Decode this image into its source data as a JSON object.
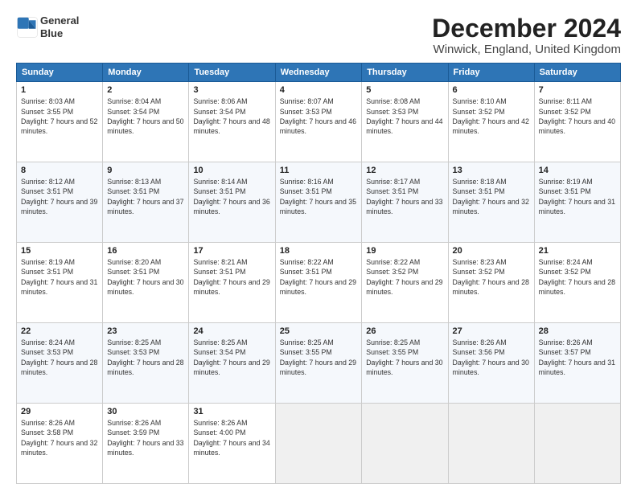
{
  "logo": {
    "line1": "General",
    "line2": "Blue"
  },
  "title": "December 2024",
  "subtitle": "Winwick, England, United Kingdom",
  "days_of_week": [
    "Sunday",
    "Monday",
    "Tuesday",
    "Wednesday",
    "Thursday",
    "Friday",
    "Saturday"
  ],
  "weeks": [
    [
      {
        "day": "1",
        "sunrise": "8:03 AM",
        "sunset": "3:55 PM",
        "daylight": "7 hours and 52 minutes."
      },
      {
        "day": "2",
        "sunrise": "8:04 AM",
        "sunset": "3:54 PM",
        "daylight": "7 hours and 50 minutes."
      },
      {
        "day": "3",
        "sunrise": "8:06 AM",
        "sunset": "3:54 PM",
        "daylight": "7 hours and 48 minutes."
      },
      {
        "day": "4",
        "sunrise": "8:07 AM",
        "sunset": "3:53 PM",
        "daylight": "7 hours and 46 minutes."
      },
      {
        "day": "5",
        "sunrise": "8:08 AM",
        "sunset": "3:53 PM",
        "daylight": "7 hours and 44 minutes."
      },
      {
        "day": "6",
        "sunrise": "8:10 AM",
        "sunset": "3:52 PM",
        "daylight": "7 hours and 42 minutes."
      },
      {
        "day": "7",
        "sunrise": "8:11 AM",
        "sunset": "3:52 PM",
        "daylight": "7 hours and 40 minutes."
      }
    ],
    [
      {
        "day": "8",
        "sunrise": "8:12 AM",
        "sunset": "3:51 PM",
        "daylight": "7 hours and 39 minutes."
      },
      {
        "day": "9",
        "sunrise": "8:13 AM",
        "sunset": "3:51 PM",
        "daylight": "7 hours and 37 minutes."
      },
      {
        "day": "10",
        "sunrise": "8:14 AM",
        "sunset": "3:51 PM",
        "daylight": "7 hours and 36 minutes."
      },
      {
        "day": "11",
        "sunrise": "8:16 AM",
        "sunset": "3:51 PM",
        "daylight": "7 hours and 35 minutes."
      },
      {
        "day": "12",
        "sunrise": "8:17 AM",
        "sunset": "3:51 PM",
        "daylight": "7 hours and 33 minutes."
      },
      {
        "day": "13",
        "sunrise": "8:18 AM",
        "sunset": "3:51 PM",
        "daylight": "7 hours and 32 minutes."
      },
      {
        "day": "14",
        "sunrise": "8:19 AM",
        "sunset": "3:51 PM",
        "daylight": "7 hours and 31 minutes."
      }
    ],
    [
      {
        "day": "15",
        "sunrise": "8:19 AM",
        "sunset": "3:51 PM",
        "daylight": "7 hours and 31 minutes."
      },
      {
        "day": "16",
        "sunrise": "8:20 AM",
        "sunset": "3:51 PM",
        "daylight": "7 hours and 30 minutes."
      },
      {
        "day": "17",
        "sunrise": "8:21 AM",
        "sunset": "3:51 PM",
        "daylight": "7 hours and 29 minutes."
      },
      {
        "day": "18",
        "sunrise": "8:22 AM",
        "sunset": "3:51 PM",
        "daylight": "7 hours and 29 minutes."
      },
      {
        "day": "19",
        "sunrise": "8:22 AM",
        "sunset": "3:52 PM",
        "daylight": "7 hours and 29 minutes."
      },
      {
        "day": "20",
        "sunrise": "8:23 AM",
        "sunset": "3:52 PM",
        "daylight": "7 hours and 28 minutes."
      },
      {
        "day": "21",
        "sunrise": "8:24 AM",
        "sunset": "3:52 PM",
        "daylight": "7 hours and 28 minutes."
      }
    ],
    [
      {
        "day": "22",
        "sunrise": "8:24 AM",
        "sunset": "3:53 PM",
        "daylight": "7 hours and 28 minutes."
      },
      {
        "day": "23",
        "sunrise": "8:25 AM",
        "sunset": "3:53 PM",
        "daylight": "7 hours and 28 minutes."
      },
      {
        "day": "24",
        "sunrise": "8:25 AM",
        "sunset": "3:54 PM",
        "daylight": "7 hours and 29 minutes."
      },
      {
        "day": "25",
        "sunrise": "8:25 AM",
        "sunset": "3:55 PM",
        "daylight": "7 hours and 29 minutes."
      },
      {
        "day": "26",
        "sunrise": "8:25 AM",
        "sunset": "3:55 PM",
        "daylight": "7 hours and 30 minutes."
      },
      {
        "day": "27",
        "sunrise": "8:26 AM",
        "sunset": "3:56 PM",
        "daylight": "7 hours and 30 minutes."
      },
      {
        "day": "28",
        "sunrise": "8:26 AM",
        "sunset": "3:57 PM",
        "daylight": "7 hours and 31 minutes."
      }
    ],
    [
      {
        "day": "29",
        "sunrise": "8:26 AM",
        "sunset": "3:58 PM",
        "daylight": "7 hours and 32 minutes."
      },
      {
        "day": "30",
        "sunrise": "8:26 AM",
        "sunset": "3:59 PM",
        "daylight": "7 hours and 33 minutes."
      },
      {
        "day": "31",
        "sunrise": "8:26 AM",
        "sunset": "4:00 PM",
        "daylight": "7 hours and 34 minutes."
      },
      null,
      null,
      null,
      null
    ]
  ]
}
